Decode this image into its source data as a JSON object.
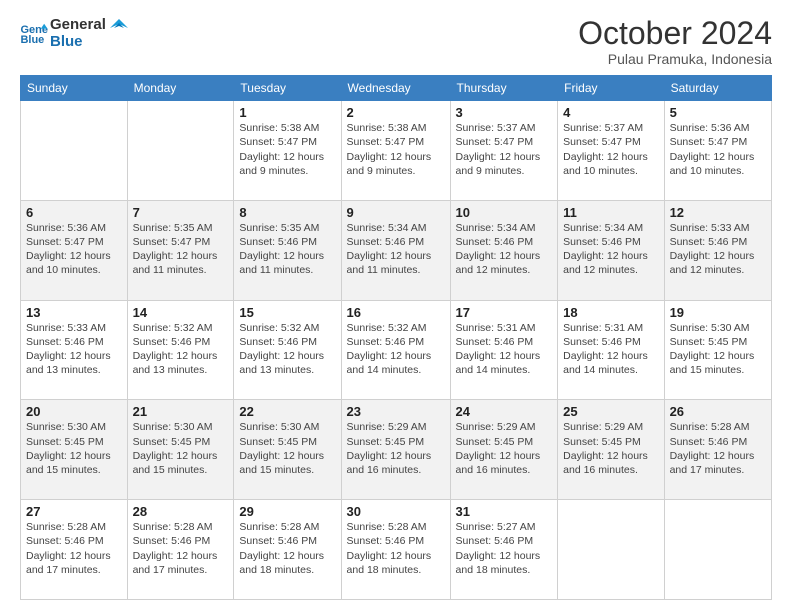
{
  "logo": {
    "line1": "General",
    "line2": "Blue"
  },
  "header": {
    "title": "October 2024",
    "subtitle": "Pulau Pramuka, Indonesia"
  },
  "days_of_week": [
    "Sunday",
    "Monday",
    "Tuesday",
    "Wednesday",
    "Thursday",
    "Friday",
    "Saturday"
  ],
  "weeks": [
    [
      {
        "day": "",
        "sunrise": "",
        "sunset": "",
        "daylight": ""
      },
      {
        "day": "",
        "sunrise": "",
        "sunset": "",
        "daylight": ""
      },
      {
        "day": "1",
        "sunrise": "Sunrise: 5:38 AM",
        "sunset": "Sunset: 5:47 PM",
        "daylight": "Daylight: 12 hours and 9 minutes."
      },
      {
        "day": "2",
        "sunrise": "Sunrise: 5:38 AM",
        "sunset": "Sunset: 5:47 PM",
        "daylight": "Daylight: 12 hours and 9 minutes."
      },
      {
        "day": "3",
        "sunrise": "Sunrise: 5:37 AM",
        "sunset": "Sunset: 5:47 PM",
        "daylight": "Daylight: 12 hours and 9 minutes."
      },
      {
        "day": "4",
        "sunrise": "Sunrise: 5:37 AM",
        "sunset": "Sunset: 5:47 PM",
        "daylight": "Daylight: 12 hours and 10 minutes."
      },
      {
        "day": "5",
        "sunrise": "Sunrise: 5:36 AM",
        "sunset": "Sunset: 5:47 PM",
        "daylight": "Daylight: 12 hours and 10 minutes."
      }
    ],
    [
      {
        "day": "6",
        "sunrise": "Sunrise: 5:36 AM",
        "sunset": "Sunset: 5:47 PM",
        "daylight": "Daylight: 12 hours and 10 minutes."
      },
      {
        "day": "7",
        "sunrise": "Sunrise: 5:35 AM",
        "sunset": "Sunset: 5:47 PM",
        "daylight": "Daylight: 12 hours and 11 minutes."
      },
      {
        "day": "8",
        "sunrise": "Sunrise: 5:35 AM",
        "sunset": "Sunset: 5:46 PM",
        "daylight": "Daylight: 12 hours and 11 minutes."
      },
      {
        "day": "9",
        "sunrise": "Sunrise: 5:34 AM",
        "sunset": "Sunset: 5:46 PM",
        "daylight": "Daylight: 12 hours and 11 minutes."
      },
      {
        "day": "10",
        "sunrise": "Sunrise: 5:34 AM",
        "sunset": "Sunset: 5:46 PM",
        "daylight": "Daylight: 12 hours and 12 minutes."
      },
      {
        "day": "11",
        "sunrise": "Sunrise: 5:34 AM",
        "sunset": "Sunset: 5:46 PM",
        "daylight": "Daylight: 12 hours and 12 minutes."
      },
      {
        "day": "12",
        "sunrise": "Sunrise: 5:33 AM",
        "sunset": "Sunset: 5:46 PM",
        "daylight": "Daylight: 12 hours and 12 minutes."
      }
    ],
    [
      {
        "day": "13",
        "sunrise": "Sunrise: 5:33 AM",
        "sunset": "Sunset: 5:46 PM",
        "daylight": "Daylight: 12 hours and 13 minutes."
      },
      {
        "day": "14",
        "sunrise": "Sunrise: 5:32 AM",
        "sunset": "Sunset: 5:46 PM",
        "daylight": "Daylight: 12 hours and 13 minutes."
      },
      {
        "day": "15",
        "sunrise": "Sunrise: 5:32 AM",
        "sunset": "Sunset: 5:46 PM",
        "daylight": "Daylight: 12 hours and 13 minutes."
      },
      {
        "day": "16",
        "sunrise": "Sunrise: 5:32 AM",
        "sunset": "Sunset: 5:46 PM",
        "daylight": "Daylight: 12 hours and 14 minutes."
      },
      {
        "day": "17",
        "sunrise": "Sunrise: 5:31 AM",
        "sunset": "Sunset: 5:46 PM",
        "daylight": "Daylight: 12 hours and 14 minutes."
      },
      {
        "day": "18",
        "sunrise": "Sunrise: 5:31 AM",
        "sunset": "Sunset: 5:46 PM",
        "daylight": "Daylight: 12 hours and 14 minutes."
      },
      {
        "day": "19",
        "sunrise": "Sunrise: 5:30 AM",
        "sunset": "Sunset: 5:45 PM",
        "daylight": "Daylight: 12 hours and 15 minutes."
      }
    ],
    [
      {
        "day": "20",
        "sunrise": "Sunrise: 5:30 AM",
        "sunset": "Sunset: 5:45 PM",
        "daylight": "Daylight: 12 hours and 15 minutes."
      },
      {
        "day": "21",
        "sunrise": "Sunrise: 5:30 AM",
        "sunset": "Sunset: 5:45 PM",
        "daylight": "Daylight: 12 hours and 15 minutes."
      },
      {
        "day": "22",
        "sunrise": "Sunrise: 5:30 AM",
        "sunset": "Sunset: 5:45 PM",
        "daylight": "Daylight: 12 hours and 15 minutes."
      },
      {
        "day": "23",
        "sunrise": "Sunrise: 5:29 AM",
        "sunset": "Sunset: 5:45 PM",
        "daylight": "Daylight: 12 hours and 16 minutes."
      },
      {
        "day": "24",
        "sunrise": "Sunrise: 5:29 AM",
        "sunset": "Sunset: 5:45 PM",
        "daylight": "Daylight: 12 hours and 16 minutes."
      },
      {
        "day": "25",
        "sunrise": "Sunrise: 5:29 AM",
        "sunset": "Sunset: 5:45 PM",
        "daylight": "Daylight: 12 hours and 16 minutes."
      },
      {
        "day": "26",
        "sunrise": "Sunrise: 5:28 AM",
        "sunset": "Sunset: 5:46 PM",
        "daylight": "Daylight: 12 hours and 17 minutes."
      }
    ],
    [
      {
        "day": "27",
        "sunrise": "Sunrise: 5:28 AM",
        "sunset": "Sunset: 5:46 PM",
        "daylight": "Daylight: 12 hours and 17 minutes."
      },
      {
        "day": "28",
        "sunrise": "Sunrise: 5:28 AM",
        "sunset": "Sunset: 5:46 PM",
        "daylight": "Daylight: 12 hours and 17 minutes."
      },
      {
        "day": "29",
        "sunrise": "Sunrise: 5:28 AM",
        "sunset": "Sunset: 5:46 PM",
        "daylight": "Daylight: 12 hours and 18 minutes."
      },
      {
        "day": "30",
        "sunrise": "Sunrise: 5:28 AM",
        "sunset": "Sunset: 5:46 PM",
        "daylight": "Daylight: 12 hours and 18 minutes."
      },
      {
        "day": "31",
        "sunrise": "Sunrise: 5:27 AM",
        "sunset": "Sunset: 5:46 PM",
        "daylight": "Daylight: 12 hours and 18 minutes."
      },
      {
        "day": "",
        "sunrise": "",
        "sunset": "",
        "daylight": ""
      },
      {
        "day": "",
        "sunrise": "",
        "sunset": "",
        "daylight": ""
      }
    ]
  ]
}
